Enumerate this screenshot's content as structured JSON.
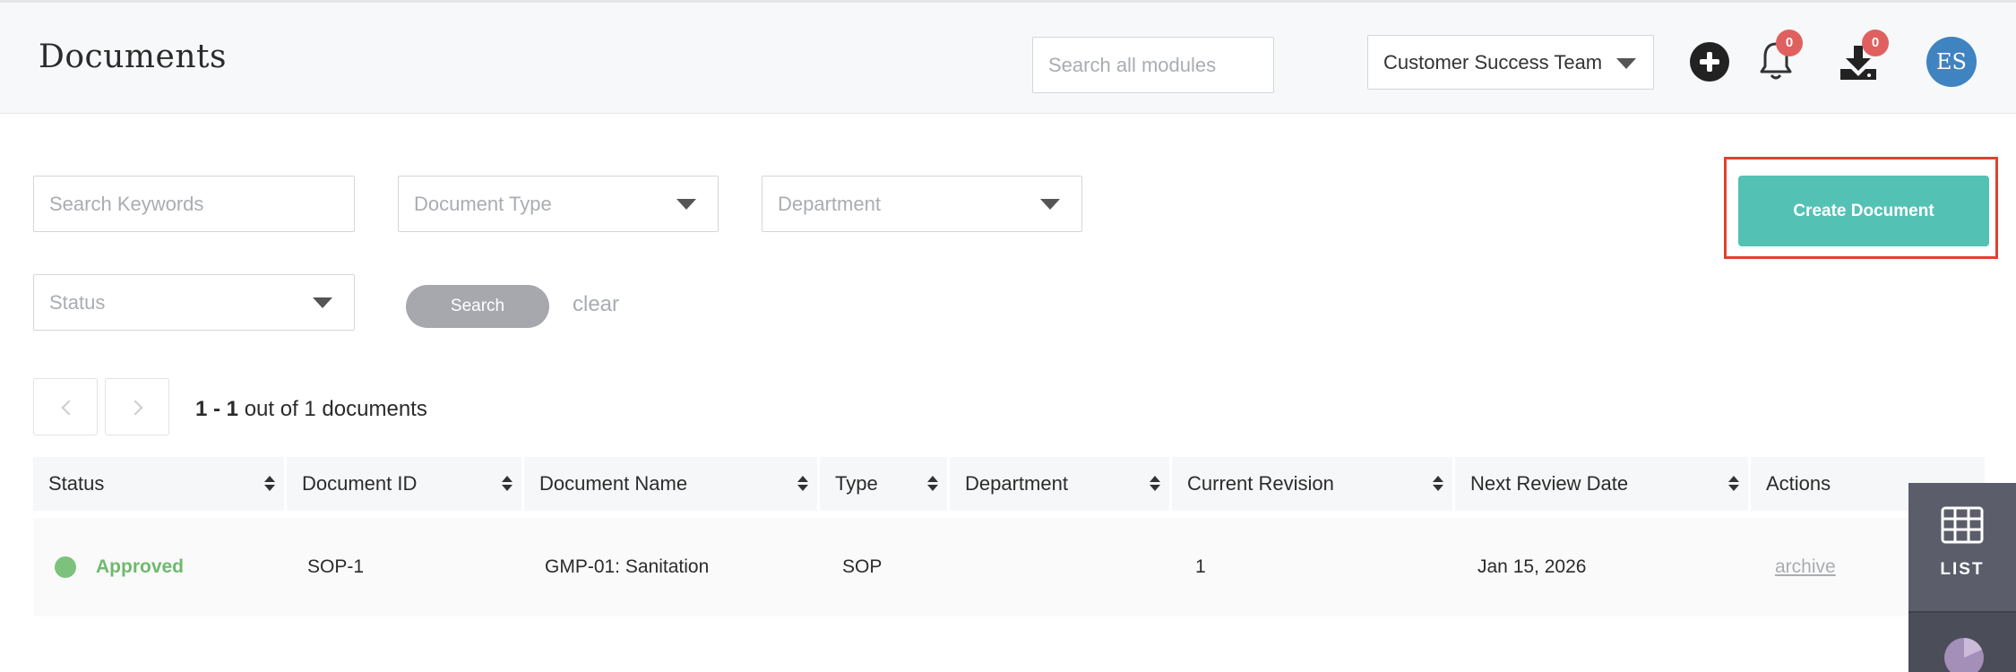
{
  "header": {
    "title": "Documents",
    "search_placeholder": "Search all modules",
    "team": "Customer Success Team",
    "notifications_count": "0",
    "downloads_count": "0",
    "avatar_initials": "ES"
  },
  "filters": {
    "keywords_placeholder": "Search Keywords",
    "document_type": "Document Type",
    "department": "Department",
    "status": "Status",
    "search_label": "Search",
    "clear_label": "clear"
  },
  "create_button": "Create Document",
  "pagination": {
    "range": "1 - 1",
    "summary": " out of 1 documents"
  },
  "table": {
    "columns": [
      "Status",
      "Document ID",
      "Document Name",
      "Type",
      "Department",
      "Current Revision",
      "Next Review Date",
      "Actions"
    ],
    "rows": [
      {
        "status": "Approved",
        "document_id": "SOP-1",
        "document_name": "GMP-01: Sanitation",
        "type": "SOP",
        "department": "",
        "current_revision": "1",
        "next_review_date": "Jan 15, 2026",
        "action": "archive"
      }
    ]
  },
  "dock": {
    "list_label": "LIST"
  },
  "colors": {
    "accent": "#54c1b5",
    "highlight": "#e0412e",
    "approved": "#6fba6e",
    "badge": "#e06060",
    "avatar": "#3f83c0"
  }
}
